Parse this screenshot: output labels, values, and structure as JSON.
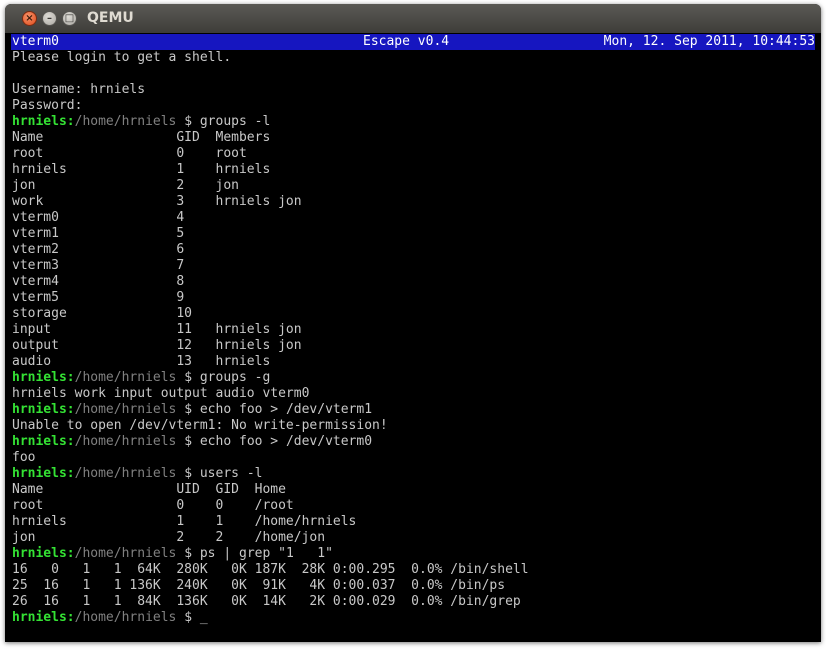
{
  "window": {
    "title": "QEMU",
    "buttons": {
      "close": "×",
      "minimize": "–",
      "maximize": "□"
    }
  },
  "status": {
    "left": "vterm0",
    "center": "Escape v0.4",
    "right": "Mon, 12. Sep 2011, 10:44:53"
  },
  "colors": {
    "status_bg": "#1616c0",
    "prompt_user": "#34e234",
    "prompt_path": "#808080",
    "text": "#c8c8c8"
  },
  "terminal": {
    "lines": [
      {
        "text": "Please login to get a shell."
      },
      {
        "text": ""
      },
      {
        "text": "Username: hrniels"
      },
      {
        "text": "Password:"
      },
      {
        "prompt": {
          "user": "hrniels",
          "sep": ":",
          "path": "/home/hrniels"
        },
        "cmd": " $ groups -l"
      },
      {
        "text": "Name                 GID  Members"
      },
      {
        "text": "root                 0    root"
      },
      {
        "text": "hrniels              1    hrniels"
      },
      {
        "text": "jon                  2    jon"
      },
      {
        "text": "work                 3    hrniels jon"
      },
      {
        "text": "vterm0               4"
      },
      {
        "text": "vterm1               5"
      },
      {
        "text": "vterm2               6"
      },
      {
        "text": "vterm3               7"
      },
      {
        "text": "vterm4               8"
      },
      {
        "text": "vterm5               9"
      },
      {
        "text": "storage              10"
      },
      {
        "text": "input                11   hrniels jon"
      },
      {
        "text": "output               12   hrniels jon"
      },
      {
        "text": "audio                13   hrniels"
      },
      {
        "prompt": {
          "user": "hrniels",
          "sep": ":",
          "path": "/home/hrniels"
        },
        "cmd": " $ groups -g"
      },
      {
        "text": "hrniels work input output audio vterm0"
      },
      {
        "prompt": {
          "user": "hrniels",
          "sep": ":",
          "path": "/home/hrniels"
        },
        "cmd": " $ echo foo > /dev/vterm1"
      },
      {
        "text": "Unable to open /dev/vterm1: No write-permission!"
      },
      {
        "prompt": {
          "user": "hrniels",
          "sep": ":",
          "path": "/home/hrniels"
        },
        "cmd": " $ echo foo > /dev/vterm0"
      },
      {
        "text": "foo"
      },
      {
        "prompt": {
          "user": "hrniels",
          "sep": ":",
          "path": "/home/hrniels"
        },
        "cmd": " $ users -l"
      },
      {
        "text": "Name                 UID  GID  Home"
      },
      {
        "text": "root                 0    0    /root"
      },
      {
        "text": "hrniels              1    1    /home/hrniels"
      },
      {
        "text": "jon                  2    2    /home/jon"
      },
      {
        "prompt": {
          "user": "hrniels",
          "sep": ":",
          "path": "/home/hrniels"
        },
        "cmd": " $ ps | grep \"1   1\""
      },
      {
        "text": "16   0   1   1  64K  280K   0K 187K  28K 0:00.295  0.0% /bin/shell"
      },
      {
        "text": "25  16   1   1 136K  240K   0K  91K   4K 0:00.037  0.0% /bin/ps"
      },
      {
        "text": "26  16   1   1  84K  136K   0K  14K   2K 0:00.029  0.0% /bin/grep"
      },
      {
        "prompt": {
          "user": "hrniels",
          "sep": ":",
          "path": "/home/hrniels"
        },
        "cmd": " $ ",
        "cursor": "_"
      }
    ]
  }
}
